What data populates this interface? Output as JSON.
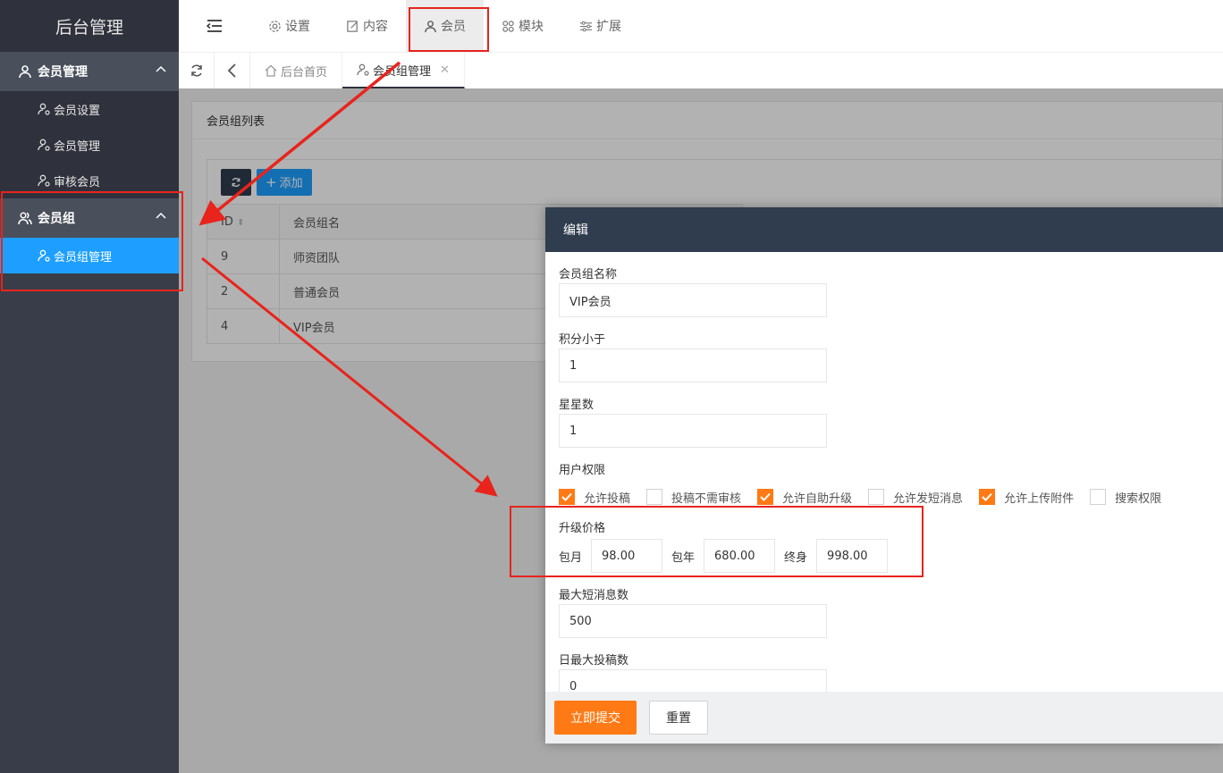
{
  "sidebar": {
    "logo": "后台管理",
    "groups": [
      {
        "label": "会员管理",
        "items": [
          {
            "label": "会员设置"
          },
          {
            "label": "会员管理"
          },
          {
            "label": "审核会员"
          }
        ]
      },
      {
        "label": "会员组",
        "items": [
          {
            "label": "会员组管理"
          }
        ]
      }
    ]
  },
  "header": {
    "nav": [
      {
        "label": "设置"
      },
      {
        "label": "内容"
      },
      {
        "label": "会员"
      },
      {
        "label": "模块"
      },
      {
        "label": "扩展"
      }
    ]
  },
  "tabs": [
    {
      "label": "后台首页"
    },
    {
      "label": "会员组管理"
    }
  ],
  "panel": {
    "title": "会员组列表",
    "add_label": "添加",
    "columns": [
      "ID",
      "会员组名"
    ],
    "rows": [
      {
        "id": "9",
        "name": "师资团队"
      },
      {
        "id": "2",
        "name": "普通会员"
      },
      {
        "id": "4",
        "name": "VIP会员"
      }
    ]
  },
  "modal": {
    "title": "编辑",
    "fields": {
      "group_name": {
        "label": "会员组名称",
        "value": "VIP会员"
      },
      "points_less": {
        "label": "积分小于",
        "value": "1"
      },
      "stars": {
        "label": "星星数",
        "value": "1"
      }
    },
    "permissions": {
      "label": "用户权限",
      "options": [
        {
          "label": "允许投稿",
          "checked": true
        },
        {
          "label": "投稿不需审核",
          "checked": false
        },
        {
          "label": "允许自助升级",
          "checked": true
        },
        {
          "label": "允许发短消息",
          "checked": false
        },
        {
          "label": "允许上传附件",
          "checked": true
        },
        {
          "label": "搜索权限",
          "checked": false
        }
      ]
    },
    "upgrade": {
      "label": "升级价格",
      "monthly_label": "包月",
      "monthly": "98.00",
      "yearly_label": "包年",
      "yearly": "680.00",
      "lifetime_label": "终身",
      "lifetime": "998.00"
    },
    "max_messages": {
      "label": "最大短消息数",
      "value": "500"
    },
    "max_daily_posts": {
      "label": "日最大投稿数",
      "value": "0"
    },
    "submit_label": "立即提交",
    "reset_label": "重置"
  },
  "colors": {
    "accent_orange": "#ff7a14",
    "active_blue": "#1e9fff",
    "annotation_red": "#e8241c"
  }
}
